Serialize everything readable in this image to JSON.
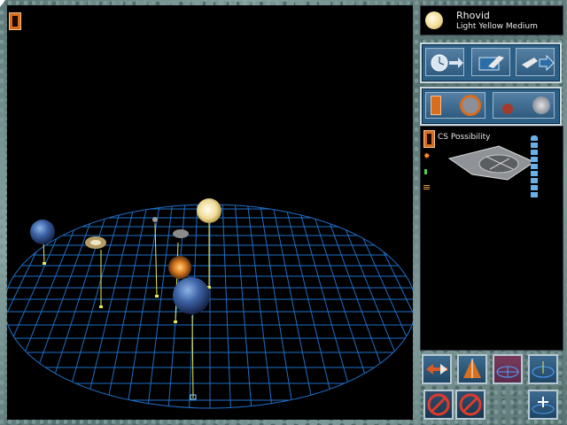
{
  "star": {
    "name": "Rhovid",
    "class": "Light Yellow Medium"
  },
  "info": {
    "label": "CS Possibility"
  },
  "icons": {
    "cursor": "arrow-cursor-icon",
    "star": "star-icon",
    "leader": "leader-portrait-icon",
    "ship": "colony-ship-icon"
  },
  "colors": {
    "grid": "#1f6fc8",
    "star": "#f2dc95",
    "stem": "#e8e85a",
    "frame": "#6e8a89",
    "button_bg": "#2b5f86"
  }
}
